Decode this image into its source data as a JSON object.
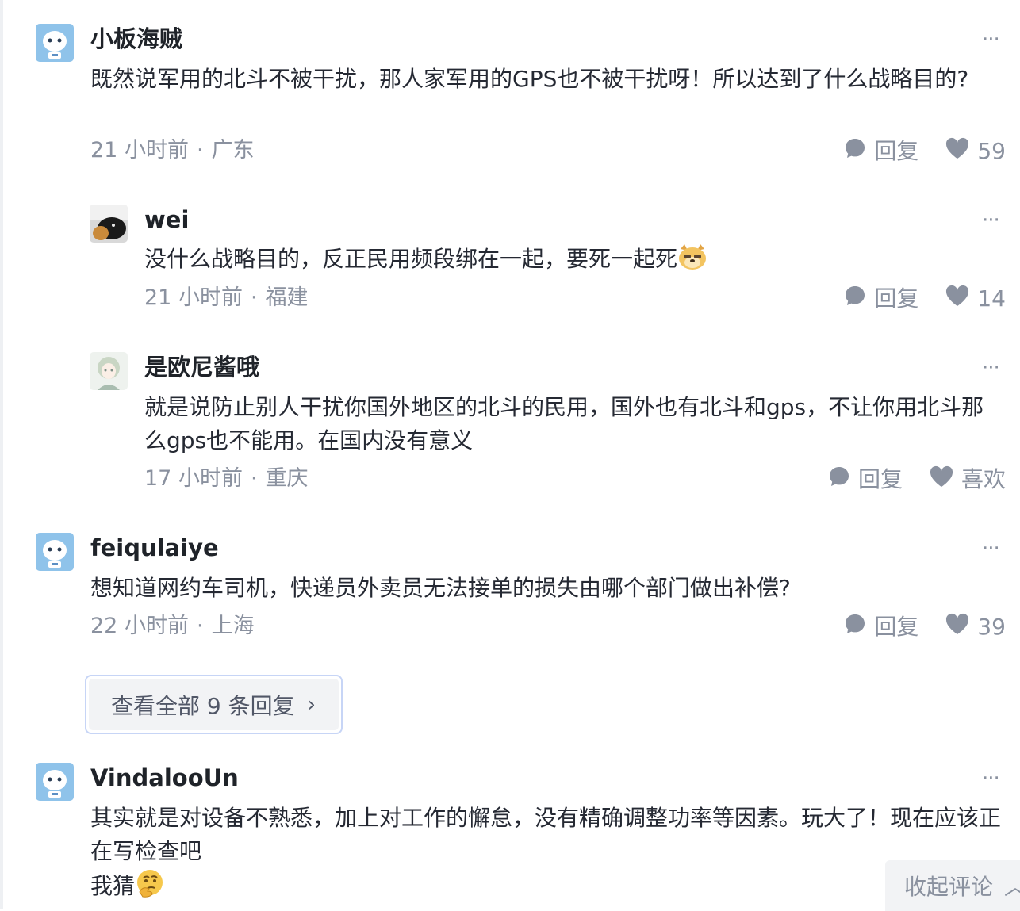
{
  "comments": [
    {
      "username": "小板海贼",
      "more": "···",
      "text": "既然说军用的北斗不被干扰，那人家军用的GPS也不被干扰呀！所以达到了什么战略目的?",
      "time": "21 小时前",
      "location": "广东",
      "reply_label": "回复",
      "likes": "59"
    },
    {
      "username": "wei",
      "more": "···",
      "text": "没什么战略目的，反正民用频段绑在一起，要死一起死",
      "time": "21 小时前",
      "location": "福建",
      "reply_label": "回复",
      "likes": "14"
    },
    {
      "username": "是欧尼酱哦",
      "more": "···",
      "text": "就是说防止别人干扰你国外地区的北斗的民用，国外也有北斗和gps，不让你用北斗那么gps也不能用。在国内没有意义",
      "time": "17 小时前",
      "location": "重庆",
      "reply_label": "回复",
      "likes": "喜欢"
    },
    {
      "username": "feiqulaiye",
      "more": "···",
      "text": "想知道网约车司机，快递员外卖员无法接单的损失由哪个部门做出补偿?",
      "time": "22 小时前",
      "location": "上海",
      "reply_label": "回复",
      "likes": "39"
    },
    {
      "username": "VindalooUn",
      "more": "···",
      "text_line1": "其实就是对设备不熟悉，加上对工作的懈怠，没有精确调整功率等因素。玩大了！现在应该正在写检查吧",
      "text_line2": "我猜"
    }
  ],
  "view_all": {
    "label": "查看全部 9 条回复",
    "chevron": "›"
  },
  "collapse": {
    "label": "收起评论",
    "caret": "︿"
  },
  "separator": "·",
  "colors": {
    "text": "#252933",
    "muted": "#8a919f",
    "accent_border": "#c7d5f6",
    "button_bg": "#f2f3f5"
  },
  "icons": [
    "robot-avatar-icon",
    "cat-avatar-icon",
    "anime-avatar-icon",
    "comment-bubble-icon",
    "heart-icon",
    "dog-emoji-icon",
    "thinking-emoji-icon"
  ]
}
